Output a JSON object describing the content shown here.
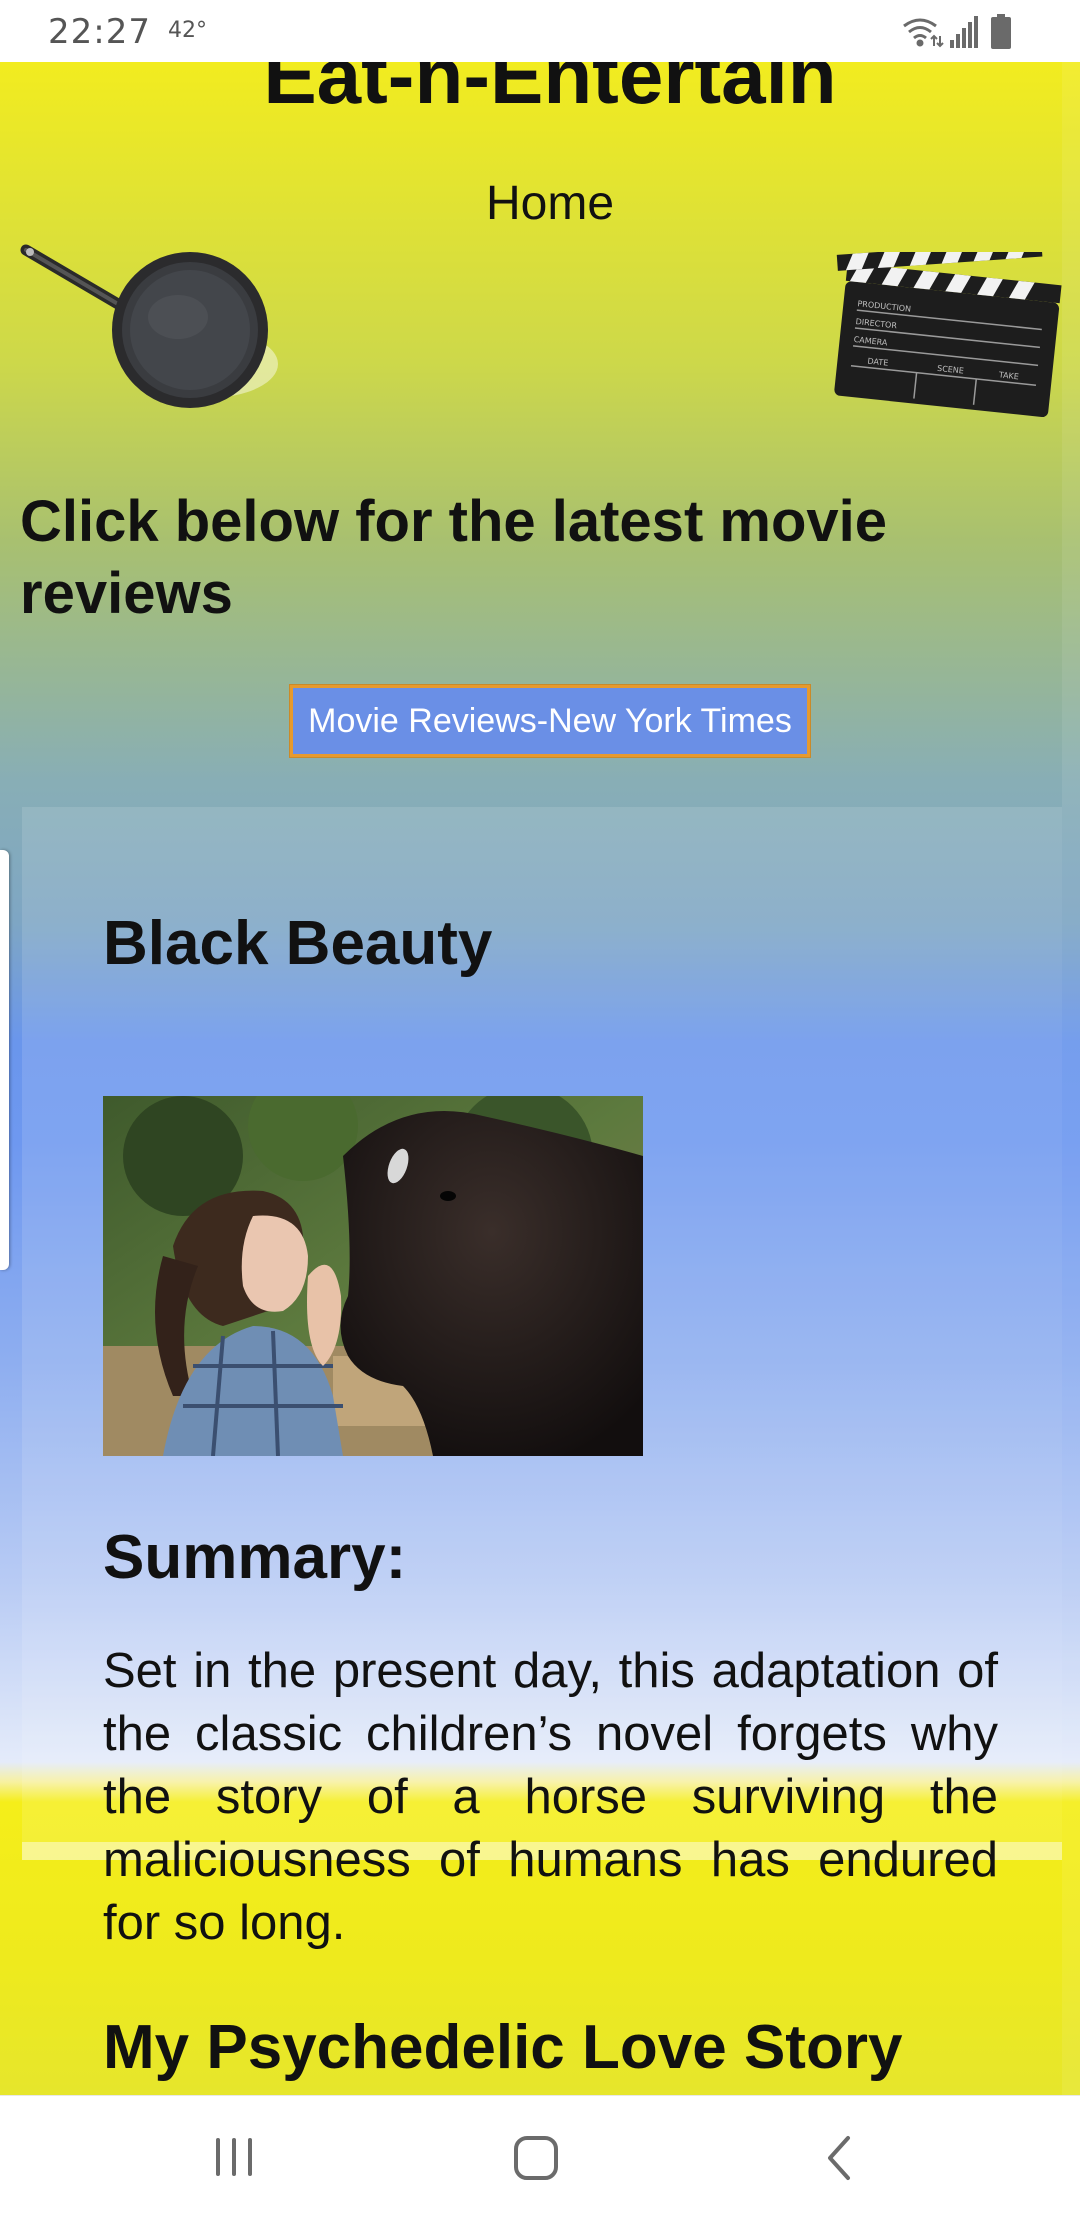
{
  "status_bar": {
    "time": "22:27",
    "temperature": "42°"
  },
  "site": {
    "title": "Eat-n-Entertain",
    "nav_home": "Home"
  },
  "promo": {
    "heading": "Click below for the latest movie reviews",
    "button_label": "Movie Reviews-New York Times",
    "button_color": "#6a8fe6",
    "button_border_color": "#e69a2e"
  },
  "movies": [
    {
      "title": "Black Beauty",
      "summary_heading": "Summary:",
      "summary": "Set in the present day, this adaptation of the classic children’s novel forgets why the story of a horse surviving the maliciousness of humans has endured for so long."
    },
    {
      "title": "My Psychedelic Love Story"
    }
  ],
  "icons": {
    "pan": "frying-pan-icon",
    "clapper": "clapperboard-icon",
    "wifi": "wifi-icon",
    "signal": "signal-icon",
    "battery": "battery-icon",
    "recents": "recent-apps-icon",
    "home": "home-icon",
    "back": "back-icon"
  }
}
